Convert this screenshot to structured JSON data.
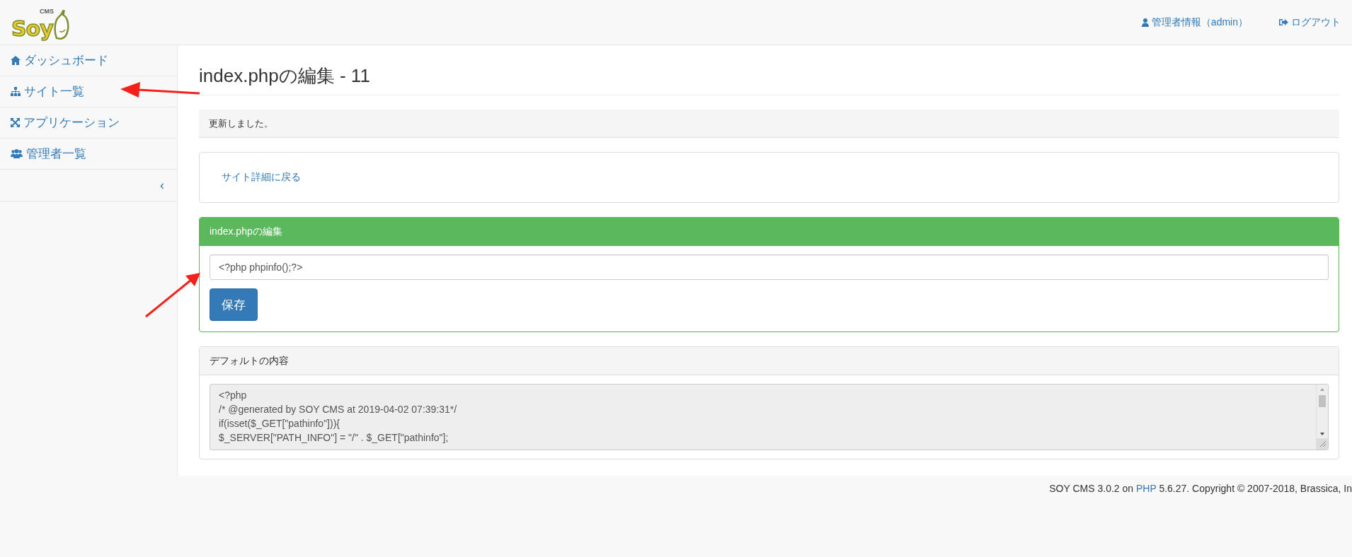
{
  "logo": {
    "text": "Soy",
    "superscript": "CMS"
  },
  "header": {
    "links": [
      {
        "kind": "user",
        "label": "管理者情報（admin）"
      },
      {
        "kind": "logout",
        "label": "ログアウト"
      }
    ]
  },
  "sidebar": {
    "items": [
      {
        "kind": "home",
        "label": "ダッシュボード"
      },
      {
        "kind": "sitemap",
        "label": "サイト一覧"
      },
      {
        "kind": "expand",
        "label": "アプリケーション"
      },
      {
        "kind": "users",
        "label": "管理者一覧"
      }
    ],
    "collapse": "‹"
  },
  "page": {
    "title": "index.phpの編集 - 11",
    "alert": "更新しました。",
    "back_link": "サイト詳細に戻る",
    "editor_panel": {
      "title": "index.phpの編集",
      "value": "<?php phpinfo();?>",
      "button": "保存"
    },
    "default_panel": {
      "title": "デフォルトの内容",
      "lines": [
        "<?php",
        "/* @generated by SOY CMS at 2019-04-02 07:39:31*/",
        "if(isset($_GET[\"pathinfo\"])){",
        "$_SERVER[\"PATH_INFO\"] = \"/\" . $_GET[\"pathinfo\"];"
      ]
    }
  },
  "footer": {
    "before": "SOY CMS 3.0.2 on ",
    "link": "PHP",
    "after": " 5.6.27. Copyright © 2007-2018, Brassica, In"
  }
}
